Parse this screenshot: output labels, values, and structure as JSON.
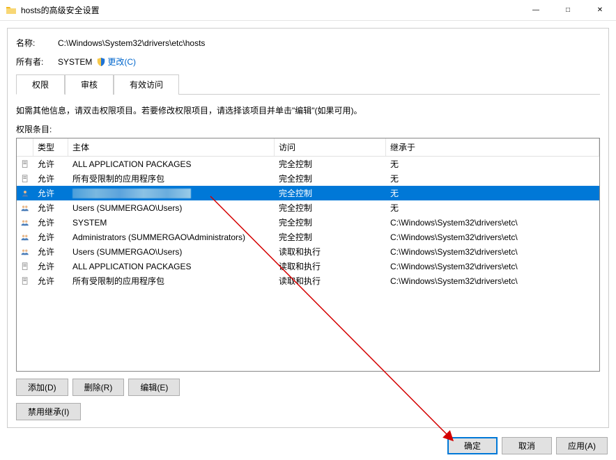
{
  "window": {
    "title": "hosts的高级安全设置"
  },
  "fields": {
    "name_label": "名称:",
    "name_value": "C:\\Windows\\System32\\drivers\\etc\\hosts",
    "owner_label": "所有者:",
    "owner_value": "SYSTEM",
    "change_label": "更改(C)"
  },
  "tabs": {
    "permissions": "权限",
    "auditing": "审核",
    "effective": "有效访问"
  },
  "hint": "如需其他信息，请双击权限项目。若要修改权限项目，请选择该项目并单击\"编辑\"(如果可用)。",
  "entries_label": "权限条目:",
  "columns": {
    "type": "类型",
    "principal": "主体",
    "access": "访问",
    "inherit": "继承于"
  },
  "rows": [
    {
      "icon": "file",
      "type": "允许",
      "principal": "ALL APPLICATION PACKAGES",
      "access": "完全控制",
      "inherit": "无",
      "selected": false
    },
    {
      "icon": "file",
      "type": "允许",
      "principal": "所有受限制的应用程序包",
      "access": "完全控制",
      "inherit": "无",
      "selected": false
    },
    {
      "icon": "person",
      "type": "允许",
      "principal": "__BLUR__",
      "access": "完全控制",
      "inherit": "无",
      "selected": true
    },
    {
      "icon": "persons",
      "type": "允许",
      "principal": "Users (SUMMERGAO\\Users)",
      "access": "完全控制",
      "inherit": "无",
      "selected": false
    },
    {
      "icon": "persons",
      "type": "允许",
      "principal": "SYSTEM",
      "access": "完全控制",
      "inherit": "C:\\Windows\\System32\\drivers\\etc\\",
      "selected": false
    },
    {
      "icon": "persons",
      "type": "允许",
      "principal": "Administrators (SUMMERGAO\\Administrators)",
      "access": "完全控制",
      "inherit": "C:\\Windows\\System32\\drivers\\etc\\",
      "selected": false
    },
    {
      "icon": "persons",
      "type": "允许",
      "principal": "Users (SUMMERGAO\\Users)",
      "access": "读取和执行",
      "inherit": "C:\\Windows\\System32\\drivers\\etc\\",
      "selected": false
    },
    {
      "icon": "file",
      "type": "允许",
      "principal": "ALL APPLICATION PACKAGES",
      "access": "读取和执行",
      "inherit": "C:\\Windows\\System32\\drivers\\etc\\",
      "selected": false
    },
    {
      "icon": "file",
      "type": "允许",
      "principal": "所有受限制的应用程序包",
      "access": "读取和执行",
      "inherit": "C:\\Windows\\System32\\drivers\\etc\\",
      "selected": false
    }
  ],
  "buttons": {
    "add": "添加(D)",
    "remove": "删除(R)",
    "edit": "编辑(E)",
    "disable_inherit": "禁用继承(I)",
    "ok": "确定",
    "cancel": "取消",
    "apply": "应用(A)"
  }
}
